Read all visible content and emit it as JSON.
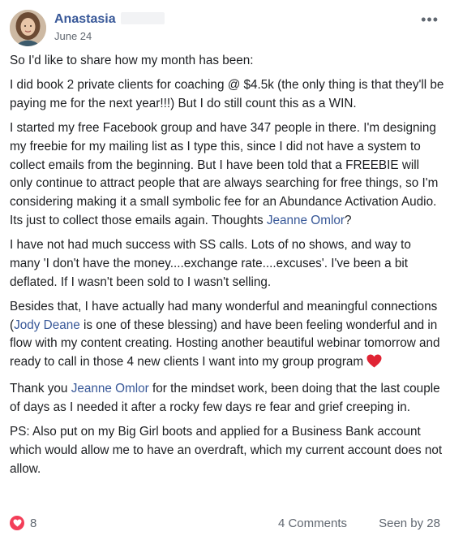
{
  "post": {
    "author": "Anastasia",
    "date": "June 24",
    "body": {
      "p1": "So I'd like to share how my month has been:",
      "p2": "I did book 2 private clients for coaching @ $4.5k (the only thing is that they'll be paying me for the next year!!!) But I do still count this as a WIN.",
      "p3_text": "I started my free Facebook group and have 347 people in there. I'm designing my freebie for my mailing list as I type this, since I did not have a system to collect emails from the beginning. But I have been told that a FREEBIE will only continue to attract people that are always searching for free things, so I'm considering making it a small symbolic fee for an Abundance Activation Audio. Its just to collect those emails again. Thoughts ",
      "p3_mention": "Jeanne Omlor",
      "p3_end": "?",
      "p4": "I have not had much success with SS calls. Lots of no shows, and way to many 'I don't have the money....exchange rate....excuses'. I've been a bit deflated. If I wasn't been sold to I wasn't selling.",
      "p5_start": "Besides that, I have actually had many wonderful and meaningful connections (",
      "p5_mention": "Jody Deane",
      "p5_end": " is one of these blessing) and have been feeling wonderful and in flow with my content creating. Hosting another beautiful webinar tomorrow and ready to call in those 4 new clients I want into my group program",
      "p6_start": "Thank you ",
      "p6_mention": "Jeanne Omlor",
      "p6_end": " for the mindset work, been doing that the last couple of days as I needed it after a rocky few days re fear and grief creeping in.",
      "p7": "PS: Also put on my Big Girl boots and applied for a Business Bank account which would allow me to have an overdraft, which my current account does not allow."
    }
  },
  "footer": {
    "reaction_count": "8",
    "comments": "4 Comments",
    "seen_by": "Seen by 28"
  },
  "icons": {
    "more": "more-options-icon",
    "heart_emoji": "red-heart-emoji",
    "reaction": "love-reaction-icon"
  },
  "colors": {
    "link": "#385898",
    "love": "#f33e58",
    "muted": "#606770"
  }
}
